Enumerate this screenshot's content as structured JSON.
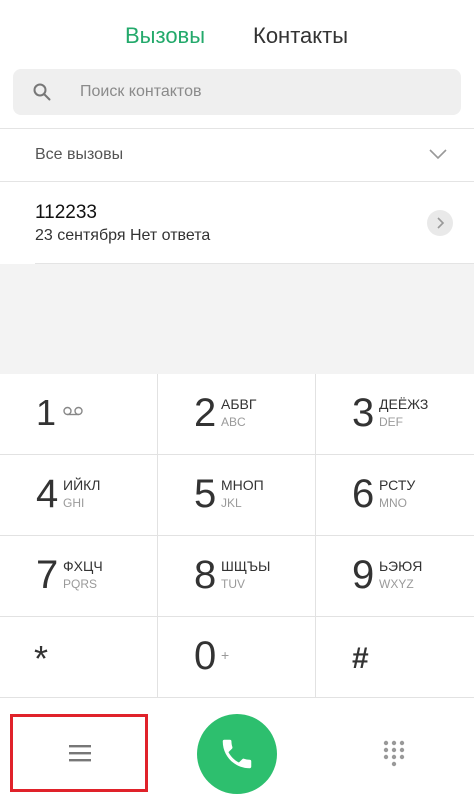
{
  "tabs": {
    "calls": "Вызовы",
    "contacts": "Контакты"
  },
  "search": {
    "placeholder": "Поиск контактов"
  },
  "filter": {
    "label": "Все вызовы"
  },
  "call_log": [
    {
      "number": "112233",
      "details": "23 сентября Нет ответа"
    }
  ],
  "keypad": [
    {
      "digit": "1",
      "letters_ru": "",
      "letters_en": "",
      "icon": "voicemail-icon"
    },
    {
      "digit": "2",
      "letters_ru": "АБВГ",
      "letters_en": "ABC"
    },
    {
      "digit": "3",
      "letters_ru": "ДЕЁЖЗ",
      "letters_en": "DEF"
    },
    {
      "digit": "4",
      "letters_ru": "ИЙКЛ",
      "letters_en": "GHI"
    },
    {
      "digit": "5",
      "letters_ru": "МНОП",
      "letters_en": "JKL"
    },
    {
      "digit": "6",
      "letters_ru": "РСТУ",
      "letters_en": "MNO"
    },
    {
      "digit": "7",
      "letters_ru": "ФХЦЧ",
      "letters_en": "PQRS"
    },
    {
      "digit": "8",
      "letters_ru": "ШЩЪЫ",
      "letters_en": "TUV"
    },
    {
      "digit": "9",
      "letters_ru": "ЬЭЮЯ",
      "letters_en": "WXYZ"
    },
    {
      "digit": "*",
      "letters_ru": "",
      "letters_en": ""
    },
    {
      "digit": "0",
      "letters_ru": "+",
      "letters_en": ""
    },
    {
      "digit": "#",
      "letters_ru": "",
      "letters_en": ""
    }
  ],
  "colors": {
    "accent": "#23a96b",
    "call_button": "#2dbf6e",
    "highlight": "#e0222a"
  },
  "icons": {
    "search": "search-icon",
    "filter": "chevron-down-icon",
    "menu": "menu-icon",
    "call": "phone-icon",
    "dialpad": "dialpad-icon"
  }
}
